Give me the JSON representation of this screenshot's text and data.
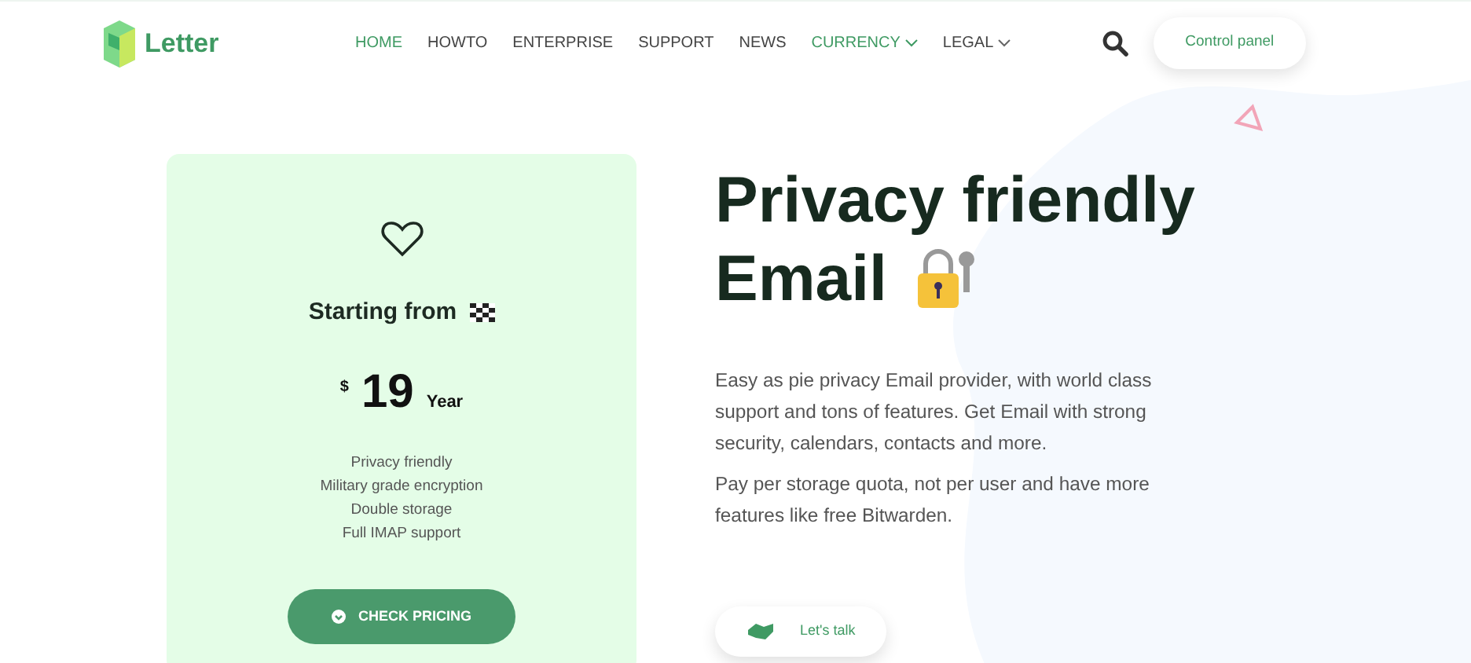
{
  "brand": {
    "name": "Letter"
  },
  "nav": [
    {
      "label": "HOME",
      "selected": true,
      "dropdown": false
    },
    {
      "label": "HOWTO",
      "selected": false,
      "dropdown": false
    },
    {
      "label": "ENTERPRISE",
      "selected": false,
      "dropdown": false
    },
    {
      "label": "SUPPORT",
      "selected": false,
      "dropdown": false
    },
    {
      "label": "NEWS",
      "selected": false,
      "dropdown": false
    },
    {
      "label": "CURRENCY",
      "selected": true,
      "dropdown": true
    },
    {
      "label": "LEGAL",
      "selected": false,
      "dropdown": true
    }
  ],
  "control_button": "Control panel",
  "pricing": {
    "title": "Starting from",
    "currency": "$",
    "price": "19",
    "period": "Year",
    "features": [
      "Privacy friendly",
      "Military grade encryption",
      "Double storage",
      "Full IMAP support"
    ],
    "button": "CHECK PRICING"
  },
  "hero": {
    "headline_line1": "Privacy friendly",
    "headline_line2": "Email",
    "paragraphs": [
      "Easy as pie privacy Email provider, with world class support and tons of features. Get Email with strong security, calendars, contacts and more.",
      "Pay per storage quota, not per user and have more features like free Bitwarden."
    ],
    "button": "Let's talk"
  }
}
